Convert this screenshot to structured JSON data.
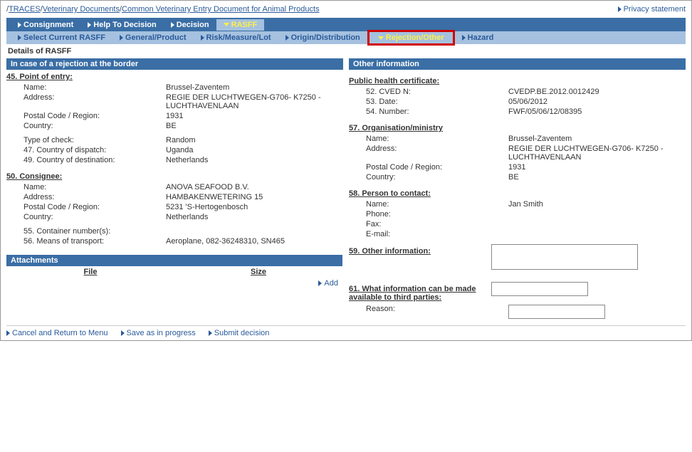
{
  "breadcrumbs": {
    "root": "TRACES",
    "mid": "Veterinary Documents",
    "leaf": "Common Veterinary Entry Document for Animal Products"
  },
  "privacy": "Privacy statement",
  "mainTabs": {
    "consignment": "Consignment",
    "help": "Help To Decision",
    "decision": "Decision",
    "rasff": "RASFF"
  },
  "subTabs": {
    "select": "Select Current RASFF",
    "general": "General/Product",
    "risk": "Risk/Measure/Lot",
    "origin": "Origin/Distribution",
    "rejection": "Rejection/Other",
    "hazard": "Hazard"
  },
  "sectionTitle": "Details of RASFF",
  "left": {
    "header": "In case of a rejection at the border",
    "g1": "45. Point of entry:",
    "name_k": "Name:",
    "name_v": "Brussel-Zaventem",
    "addr_k": "Address:",
    "addr_v": "REGIE DER LUCHTWEGEN-G706- K7250 - LUCHTHAVENLAAN",
    "postal_k": "Postal Code / Region:",
    "postal_v": "1931",
    "country_k": "Country:",
    "country_v": "BE",
    "check_k": "Type of check:",
    "check_v": "Random",
    "disp_k": "47. Country of dispatch:",
    "disp_v": "Uganda",
    "dest_k": "49. Country of destination:",
    "dest_v": "Netherlands",
    "g2": "50. Consignee:",
    "c_name_v": "ANOVA SEAFOOD B.V.",
    "c_addr_v": "HAMBAKENWETERING 15",
    "c_postal_v": "5231 'S-Hertogenbosch",
    "c_country_v": "Netherlands",
    "cont_k": "55. Container number(s):",
    "means_k": "56. Means of transport:",
    "means_v": "Aeroplane, 082-36248310, SN465"
  },
  "right": {
    "header": "Other information",
    "g1": "Public health certificate:",
    "cved_k": "52. CVED N:",
    "cved_v": "CVEDP.BE.2012.0012429",
    "date_k": "53. Date:",
    "date_v": "05/06/2012",
    "num_k": "54. Number:",
    "num_v": "FWF/05/06/12/08395",
    "g2": "57. Organisation/ministry",
    "o_name_v": "Brussel-Zaventem",
    "o_addr_v": "REGIE DER LUCHTWEGEN-G706- K7250 - LUCHTHAVENLAAN",
    "o_postal_v": "1931",
    "o_country_v": "BE",
    "g3": "58. Person to contact:",
    "p_name_k": "Name:",
    "p_name_v": "Jan Smith",
    "p_phone_k": "Phone:",
    "p_fax_k": "Fax:",
    "p_email_k": "E-mail:",
    "g4": "59. Other information:",
    "g5": "61. What information can be made available to third parties:",
    "reason_k": "Reason:"
  },
  "att": {
    "title": "Attachments",
    "file": "File",
    "size": "Size",
    "add": "Add"
  },
  "footer": {
    "cancel": "Cancel and Return to Menu",
    "save": "Save as in progress",
    "submit": "Submit decision"
  }
}
